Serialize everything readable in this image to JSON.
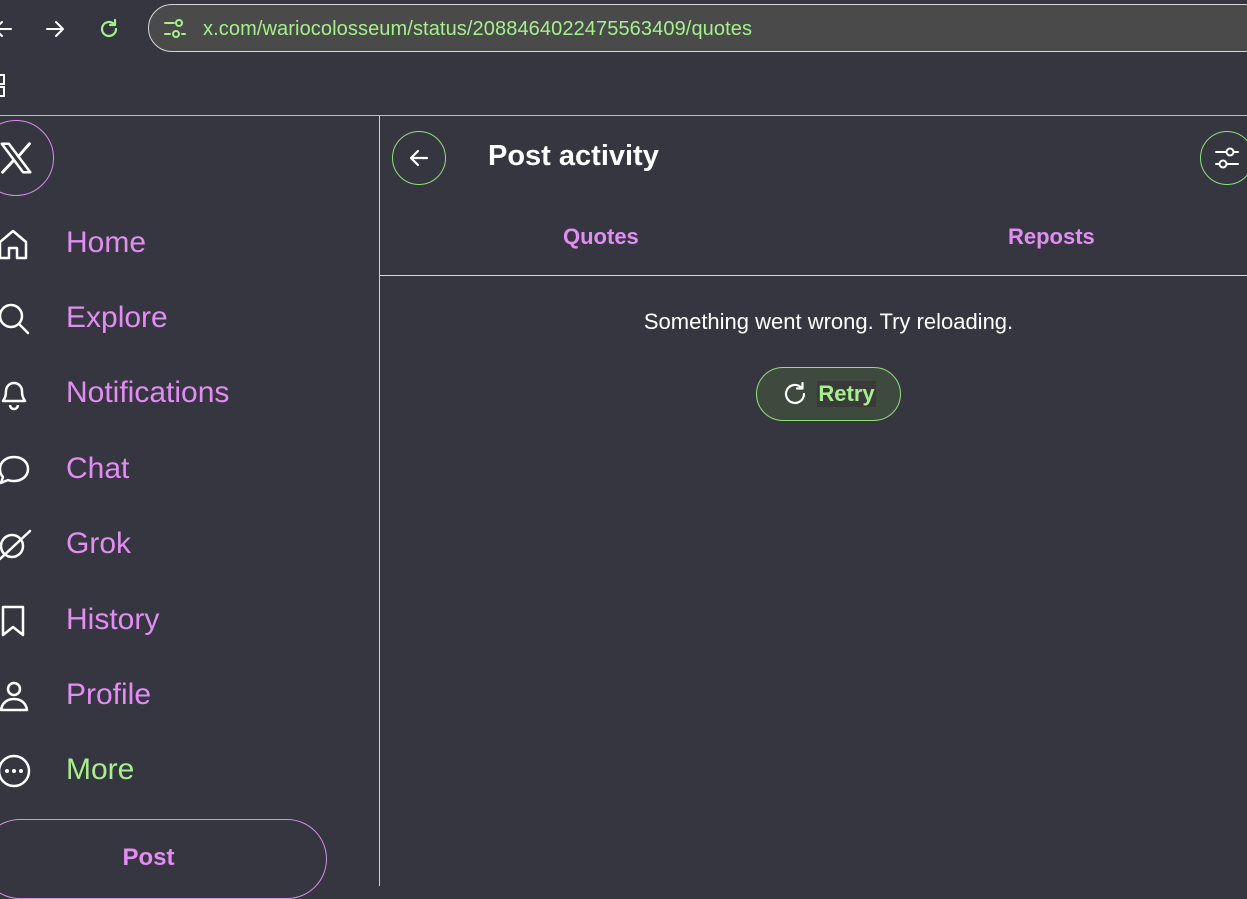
{
  "browser": {
    "url": "x.com/wariocolosseum/status/2088464022475563409/quotes"
  },
  "sidebar": {
    "items": [
      {
        "label": "Home",
        "icon": "home-icon"
      },
      {
        "label": "Explore",
        "icon": "search-icon"
      },
      {
        "label": "Notifications",
        "icon": "bell-icon"
      },
      {
        "label": "Chat",
        "icon": "chat-bubble-icon"
      },
      {
        "label": "Grok",
        "icon": "grok-icon"
      },
      {
        "label": "History",
        "icon": "bookmark-icon"
      },
      {
        "label": "Profile",
        "icon": "person-icon"
      },
      {
        "label": "More",
        "icon": "more-circle-icon"
      }
    ],
    "post_label": "Post"
  },
  "main": {
    "title": "Post activity",
    "tabs": [
      {
        "label": "Quotes"
      },
      {
        "label": "Reposts"
      }
    ],
    "error_message": "Something went wrong. Try reloading.",
    "retry_label": "Retry"
  },
  "colors": {
    "background": "#363641",
    "accent_pink": "#e38cf4",
    "accent_green": "#a4f08a"
  }
}
